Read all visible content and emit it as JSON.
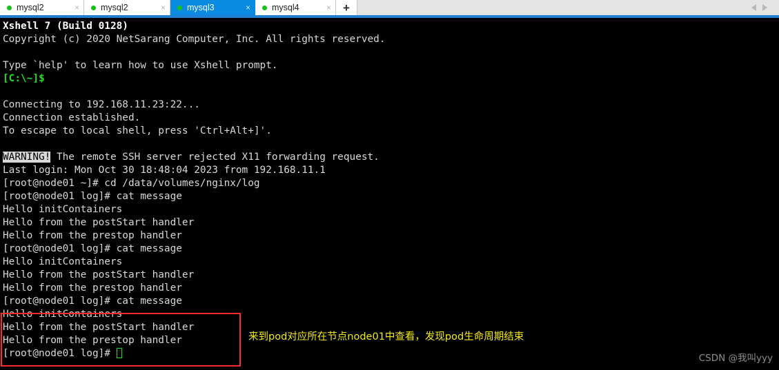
{
  "app": {
    "title": "Xshell 7 - mysql3"
  },
  "tabbar": {
    "tabs": [
      {
        "label": "mysql2",
        "status": "connected",
        "close": "×",
        "active": false
      },
      {
        "label": "mysql2",
        "status": "connected",
        "close": "×",
        "active": false
      },
      {
        "label": "mysql3",
        "status": "connected",
        "close": "×",
        "active": true
      },
      {
        "label": "mysql4",
        "status": "connected",
        "close": "×",
        "active": false
      }
    ],
    "new_tab_label": "+",
    "scroll_left_label": "◀",
    "scroll_right_label": "▶"
  },
  "terminal": {
    "lines": [
      {
        "text": "Xshell 7 (Build 0128)",
        "style": "bold"
      },
      {
        "text": "Copyright (c) 2020 NetSarang Computer, Inc. All rights reserved.",
        "style": "white"
      },
      {
        "text": "",
        "style": "white"
      },
      {
        "text": "Type `help' to learn how to use Xshell prompt.",
        "style": "white"
      },
      {
        "text": "[C:\\~]$",
        "style": "green"
      },
      {
        "text": "",
        "style": "white"
      },
      {
        "text": "Connecting to 192.168.11.23:22...",
        "style": "white"
      },
      {
        "text": "Connection established.",
        "style": "white"
      },
      {
        "text": "To escape to local shell, press 'Ctrl+Alt+]'.",
        "style": "white"
      },
      {
        "text": "",
        "style": "white"
      },
      {
        "text": "WARNING!",
        "style": "inverse",
        "suffix": " The remote SSH server rejected X11 forwarding request."
      },
      {
        "text": "Last login: Mon Oct 30 18:48:04 2023 from 192.168.11.1",
        "style": "white"
      },
      {
        "text": "[root@node01 ~]# cd /data/volumes/nginx/log",
        "style": "white"
      },
      {
        "text": "[root@node01 log]# cat message",
        "style": "white"
      },
      {
        "text": "Hello initContainers",
        "style": "white"
      },
      {
        "text": "Hello from the postStart handler",
        "style": "white"
      },
      {
        "text": "Hello from the prestop handler",
        "style": "white"
      },
      {
        "text": "[root@node01 log]# cat message",
        "style": "white"
      },
      {
        "text": "Hello initContainers",
        "style": "white"
      },
      {
        "text": "Hello from the postStart handler",
        "style": "white"
      },
      {
        "text": "Hello from the prestop handler",
        "style": "white"
      },
      {
        "text": "[root@node01 log]# cat message",
        "style": "white"
      },
      {
        "text": "Hello initContainers",
        "style": "white"
      },
      {
        "text": "Hello from the postStart handler",
        "style": "white"
      },
      {
        "text": "Hello from the prestop handler",
        "style": "white"
      },
      {
        "text": "[root@node01 log]# ",
        "style": "white",
        "cursor": true
      }
    ]
  },
  "annotation": {
    "text": "来到pod对应所在节点node01中查看，发现pod生命周期结束",
    "color": "#f2ea15",
    "highlight_color": "#fb2c2c"
  },
  "watermark": {
    "text": "CSDN @我叫yyy"
  },
  "colors": {
    "terminal_bg": "#000000",
    "terminal_fg": "#d8d8d8",
    "prompt_green": "#1ee01e",
    "active_tab": "#0a8ae0",
    "tab_underline": "#1e7fd4"
  }
}
